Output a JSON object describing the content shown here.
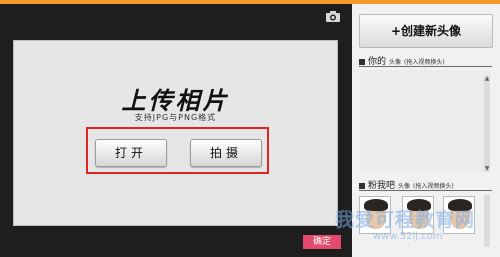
{
  "upload": {
    "title": "上传相片",
    "subtitle": "支持JPG与PNG格式",
    "open_label": "打开",
    "shoot_label": "拍摄"
  },
  "footer": {
    "confirm_label": "确定"
  },
  "sidebar": {
    "create_label": "+创建新头像",
    "mine": {
      "title": "你的",
      "small": "头像",
      "hint": "(拖入视频换头)"
    },
    "fans": {
      "title": "粉我吧",
      "small": "头像",
      "hint": "(拖入视频换头)"
    }
  },
  "watermark": {
    "text": "我爱可程教育网",
    "url": "www.52ij.com"
  },
  "icons": {
    "camera": "camera-icon"
  },
  "colors": {
    "accent": "#f39a2a",
    "highlight_frame": "#e02424",
    "confirm": "#e24b6b"
  }
}
